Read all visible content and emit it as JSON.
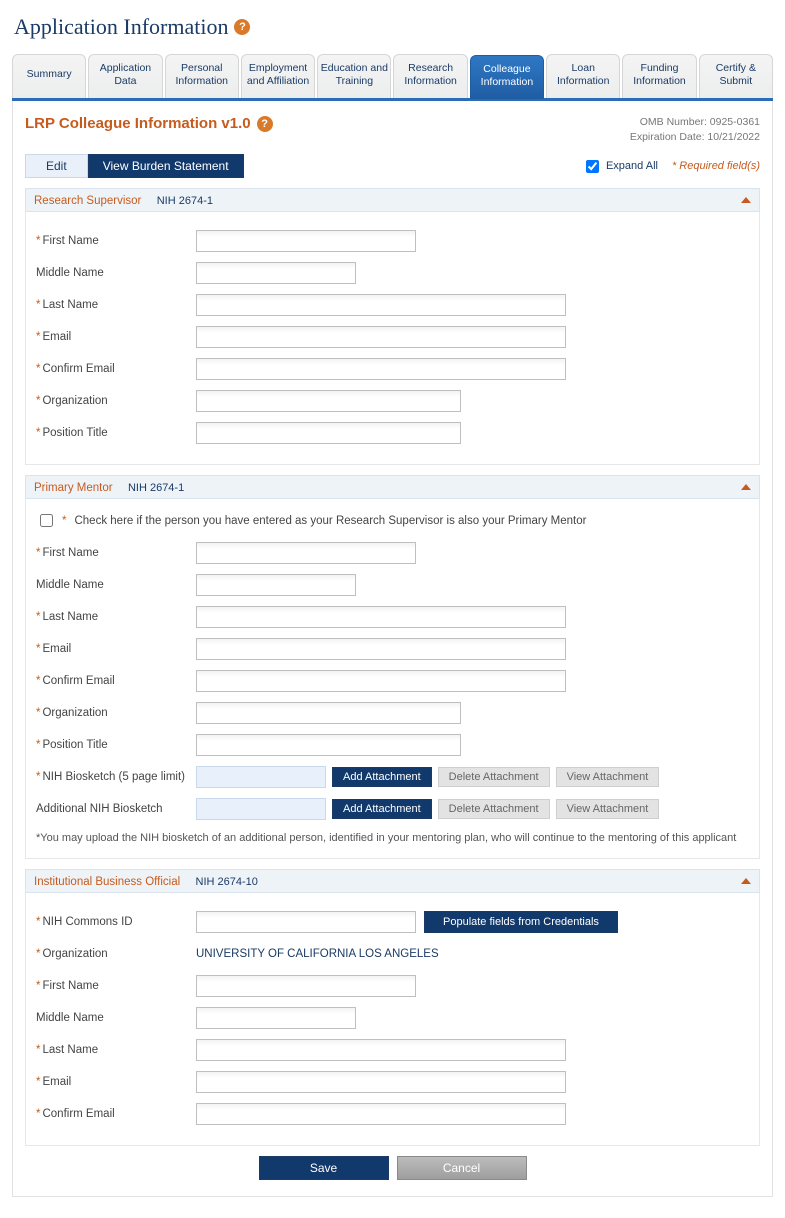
{
  "pageTitle": "Application Information",
  "tabs": [
    "Summary",
    "Application Data",
    "Personal Information",
    "Employment and Affiliation",
    "Education and Training",
    "Research Information",
    "Colleague Information",
    "Loan Information",
    "Funding Information",
    "Certify & Submit"
  ],
  "activeTabIndex": 6,
  "panelTitle": "LRP Colleague Information v1.0",
  "ombNumber": "OMB Number: 0925-0361",
  "expiration": "Expiration Date: 10/21/2022",
  "editLabel": "Edit",
  "burdenLabel": "View Burden Statement",
  "expandAllLabel": "Expand All",
  "expandAllChecked": true,
  "requiredNote": "* Required field(s)",
  "sections": {
    "supervisor": {
      "title": "Research Supervisor",
      "code": "NIH 2674-1"
    },
    "mentor": {
      "title": "Primary Mentor",
      "code": "NIH 2674-1",
      "checkboxLabel": "Check here if the person you have entered as your Research Supervisor is also your Primary Mentor"
    },
    "ibo": {
      "title": "Institutional Business Official",
      "code": "NIH 2674-10"
    }
  },
  "labels": {
    "firstName": "First Name",
    "middleName": "Middle Name",
    "lastName": "Last Name",
    "email": "Email",
    "confirmEmail": "Confirm Email",
    "organization": "Organization",
    "positionTitle": "Position Title",
    "biosketch": "NIH Biosketch (5 page limit)",
    "addlBiosketch": "Additional NIH Biosketch",
    "nihCommonsId": "NIH Commons ID"
  },
  "buttons": {
    "addAttachment": "Add Attachment",
    "deleteAttachment": "Delete Attachment",
    "viewAttachment": "View Attachment",
    "populate": "Populate fields from Credentials",
    "save": "Save",
    "cancel": "Cancel"
  },
  "biosketchNote": "*You may upload the NIH biosketch of an additional person, identified in your mentoring plan, who will continue to the mentoring of this applicant",
  "iboOrgValue": "UNIVERSITY OF CALIFORNIA LOS ANGELES"
}
